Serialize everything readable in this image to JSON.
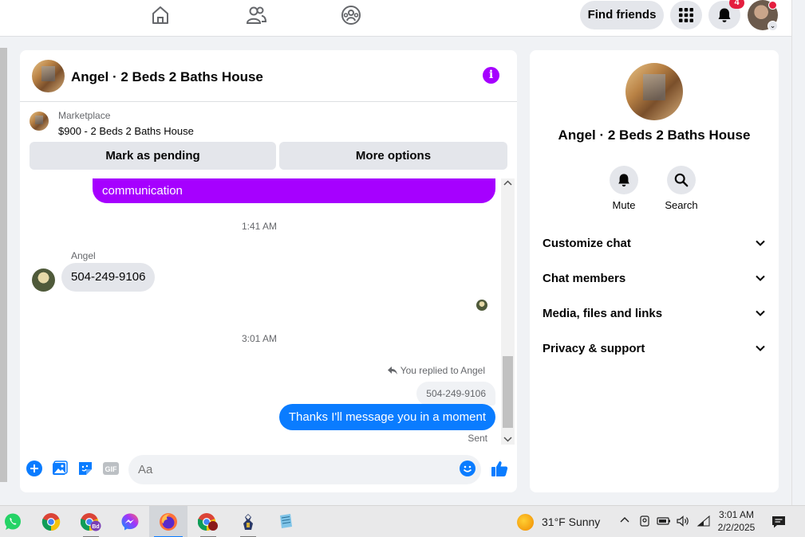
{
  "topbar": {
    "nav_icons": [
      "home-icon",
      "friends-icon",
      "groups-icon"
    ],
    "find_friends_label": "Find friends",
    "notification_count": "4"
  },
  "chat": {
    "title": "Angel · 2 Beds 2 Baths House",
    "marketplace_label": "Marketplace",
    "listing": "$900 - 2 Beds 2 Baths House",
    "mark_pending_label": "Mark as pending",
    "more_options_label": "More options",
    "messages": {
      "partial_outgoing": "communication",
      "timestamp_1": "1:41 AM",
      "sender_name": "Angel",
      "incoming_text": "504-249-9106",
      "timestamp_2": "3:01 AM",
      "replied_note": "You replied to Angel",
      "quoted_text": "504-249-9106",
      "outgoing_text": "Thanks I'll message you in a moment",
      "status": "Sent"
    },
    "composer": {
      "placeholder": "Aa"
    },
    "accent_color": "#a600ff",
    "outgoing_color": "#0a7cff"
  },
  "info_panel": {
    "title": "Angel · 2 Beds 2 Baths House",
    "mute_label": "Mute",
    "search_label": "Search",
    "sections": [
      "Customize chat",
      "Chat members",
      "Media, files and links",
      "Privacy & support"
    ]
  },
  "taskbar": {
    "apps": [
      "whatsapp",
      "chrome",
      "chrome-profile-bd",
      "messenger",
      "firefox",
      "chrome-profile-2",
      "app-game",
      "notepad"
    ],
    "weather": "31°F  Sunny",
    "time": "3:01 AM",
    "date": "2/2/2025"
  }
}
